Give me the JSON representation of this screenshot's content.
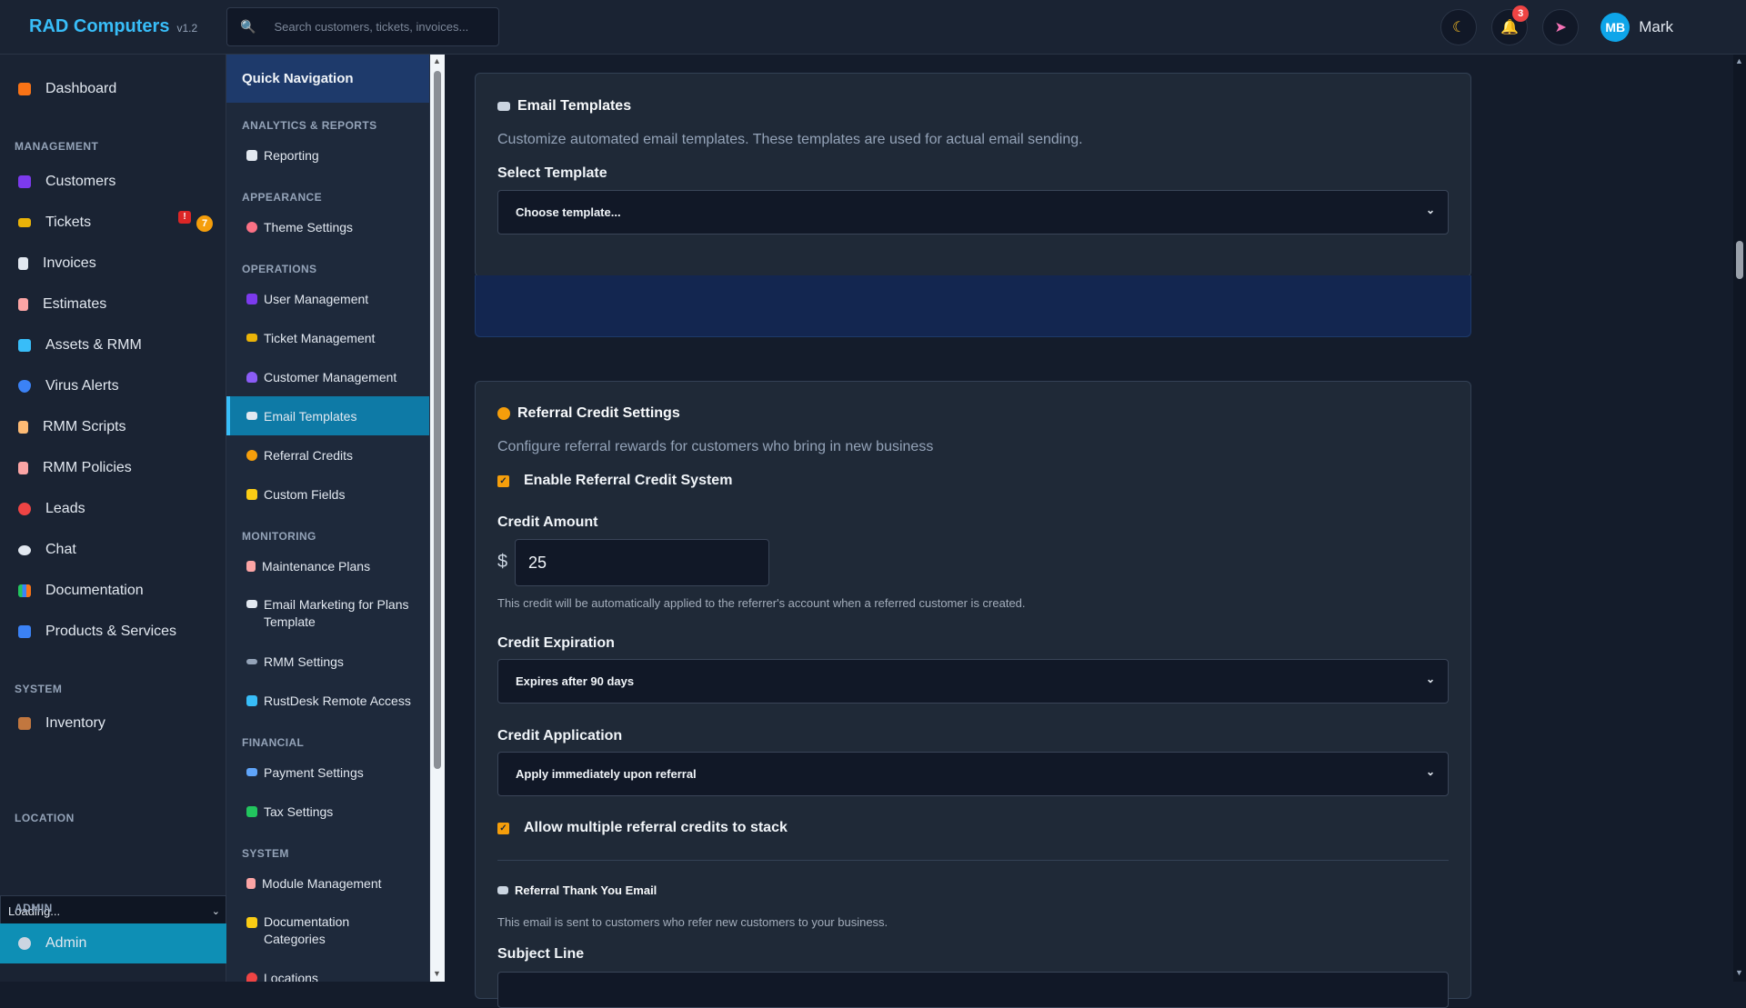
{
  "header": {
    "brand": "RAD Computers",
    "version": "v1.2",
    "search_placeholder": "Search customers, tickets, invoices...",
    "notification_count": "3",
    "user_initials": "MB",
    "user_name": "Mark"
  },
  "sidebar": {
    "dashboard": "Dashboard",
    "management_label": "MANAGEMENT",
    "customers": "Customers",
    "tickets": "Tickets",
    "tickets_alert": "!",
    "tickets_count": "7",
    "invoices": "Invoices",
    "estimates": "Estimates",
    "assets": "Assets & RMM",
    "virus_alerts": "Virus Alerts",
    "rmm_scripts": "RMM Scripts",
    "rmm_policies": "RMM Policies",
    "leads": "Leads",
    "chat": "Chat",
    "documentation": "Documentation",
    "products": "Products & Services",
    "system_label": "SYSTEM",
    "inventory": "Inventory",
    "location_label": "LOCATION",
    "location_value": "Loading...",
    "admin_label": "ADMIN",
    "admin": "Admin"
  },
  "quick_nav": {
    "title": "Quick Navigation",
    "sec_analytics": "ANALYTICS & REPORTS",
    "reporting": "Reporting",
    "sec_appearance": "APPEARANCE",
    "theme_settings": "Theme Settings",
    "sec_operations": "OPERATIONS",
    "user_management": "User Management",
    "ticket_management": "Ticket Management",
    "customer_management": "Customer Management",
    "email_templates": "Email Templates",
    "referral_credits": "Referral Credits",
    "custom_fields": "Custom Fields",
    "sec_monitoring": "MONITORING",
    "maintenance_plans": "Maintenance Plans",
    "email_marketing": "Email Marketing for Plans Template",
    "rmm_settings": "RMM Settings",
    "rustdesk": "RustDesk Remote Access",
    "sec_financial": "FINANCIAL",
    "payment_settings": "Payment Settings",
    "tax_settings": "Tax Settings",
    "sec_system": "SYSTEM",
    "module_management": "Module Management",
    "doc_categories": "Documentation Categories",
    "locations": "Locations"
  },
  "email_card": {
    "title": "Email Templates",
    "description": "Customize automated email templates. These templates are used for actual email sending.",
    "select_label": "Select Template",
    "select_value": "Choose template..."
  },
  "referral_card": {
    "title": "Referral Credit Settings",
    "description": "Configure referral rewards for customers who bring in new business",
    "enable_label": "Enable Referral Credit System",
    "amount_label": "Credit Amount",
    "currency": "$",
    "amount_value": "25",
    "amount_hint": "This credit will be automatically applied to the referrer's account when a referred customer is created.",
    "expiration_label": "Credit Expiration",
    "expiration_value": "Expires after 90 days",
    "application_label": "Credit Application",
    "application_value": "Apply immediately upon referral",
    "stack_label": "Allow multiple referral credits to stack",
    "thank_you_title": "Referral Thank You Email",
    "thank_you_hint": "This email is sent to customers who refer new customers to your business.",
    "subject_label": "Subject Line"
  }
}
